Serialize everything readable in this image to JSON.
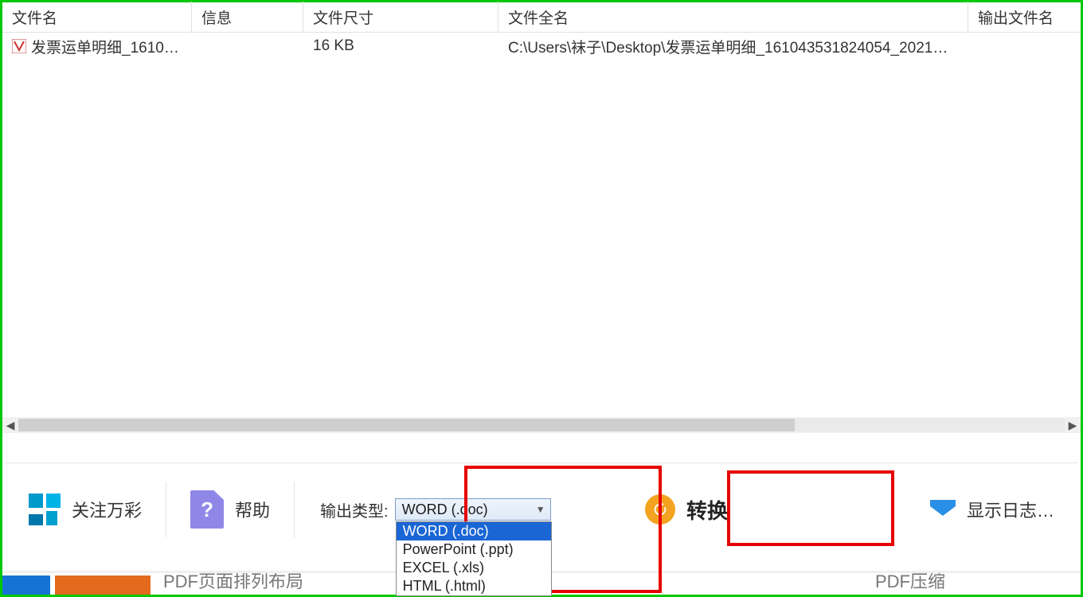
{
  "headers": {
    "name": "文件名",
    "info": "信息",
    "size": "文件尺寸",
    "fullname": "文件全名",
    "outname": "输出文件名"
  },
  "rows": [
    {
      "name": "发票运单明细_1610…",
      "info": "",
      "size": "16 KB",
      "fullname": "C:\\Users\\袜子\\Desktop\\发票运单明细_161043531824054_2021…",
      "outname": ""
    }
  ],
  "toolbar": {
    "follow_label": "关注万彩",
    "help_label": "帮助",
    "output_type_label": "输出类型:",
    "convert_label": "转换",
    "show_log_label": "显示日志…"
  },
  "output_type": {
    "selected": "WORD (.doc)",
    "options": [
      "WORD (.doc)",
      "PowerPoint (.ppt)",
      "EXCEL (.xls)",
      "HTML (.html)"
    ]
  },
  "bottom_tabs": {
    "left": "PDF页面排列布局",
    "right": "PDF压缩"
  }
}
